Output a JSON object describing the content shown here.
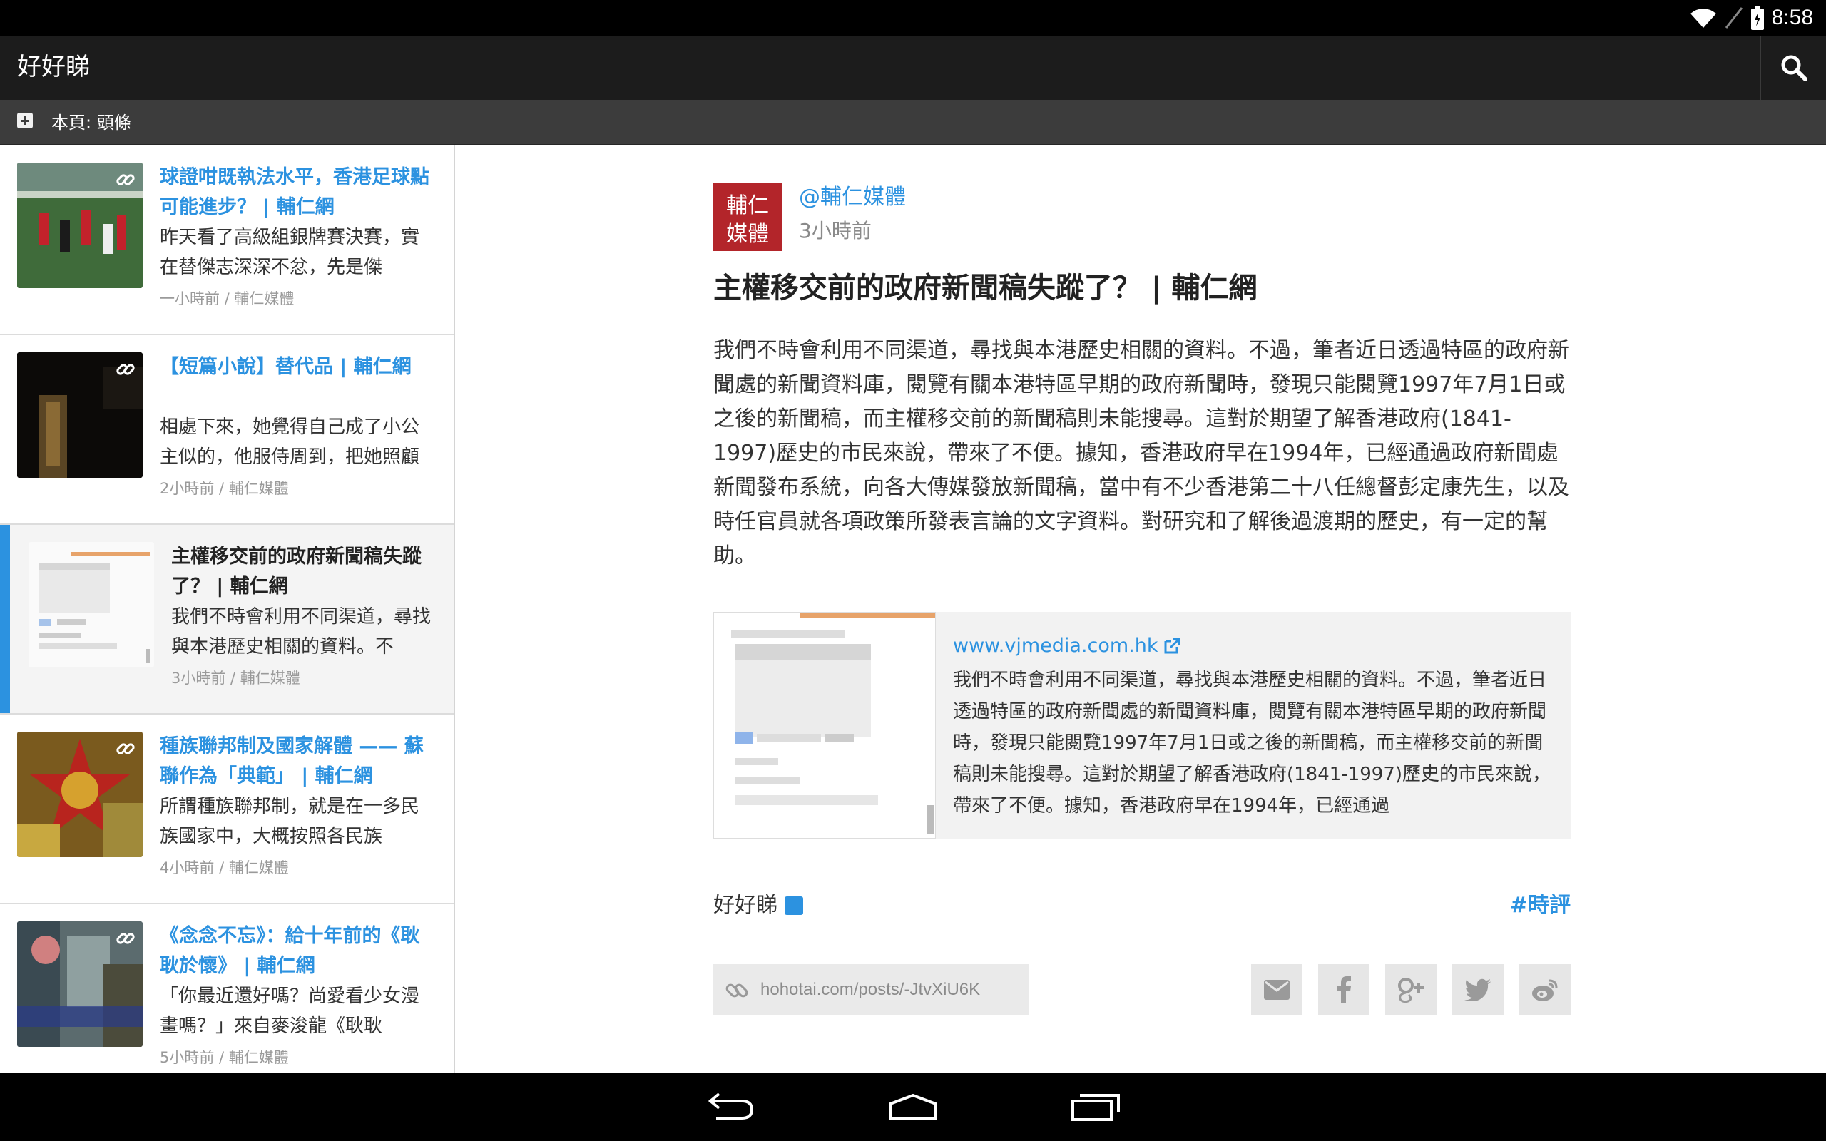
{
  "status": {
    "time": "8:58"
  },
  "app": {
    "title": "好好睇"
  },
  "subbar": {
    "page_label": "本頁: 頭條"
  },
  "feed": [
    {
      "title": "球證咁既執法水平，香港足球點可能進步？ | 輔仁網",
      "snippet": "昨天看了高級組銀牌賽決賽，實在替傑志深深不忿，先是傑",
      "meta": "一小時前 / 輔仁媒體"
    },
    {
      "title": "【短篇小說】替代品 | 輔仁網",
      "snippet": "相處下來，她覺得自己成了小公主似的，他服侍周到，把她照顧得無微不至。他在一間頗",
      "meta": "2小時前 / 輔仁媒體"
    },
    {
      "title": "主權移交前的政府新聞稿失蹤了？ | 輔仁網",
      "snippet": "我們不時會利用不同渠道，尋找與本港歷史相關的資料。不",
      "meta": "3小時前 / 輔仁媒體"
    },
    {
      "title": "種族聯邦制及國家解體 —— 蘇聯作為「典範」 | 輔仁網",
      "snippet": "所謂種族聯邦制，就是在一多民族國家中，大概按照各民族",
      "meta": "4小時前 / 輔仁媒體"
    },
    {
      "title": "《念念不忘》：給十年前的《耿耿於懷》 | 輔仁網",
      "snippet": "「你最近還好嗎？尚愛看少女漫畫嗎？」來自麥浚龍《耿耿",
      "meta": "5小時前 / 輔仁媒體"
    }
  ],
  "article": {
    "avatar_text": "輔仁媒體",
    "author": "@輔仁媒體",
    "time": "3小時前",
    "title": "主權移交前的政府新聞稿失蹤了？ | 輔仁網",
    "body": "我們不時會利用不同渠道，尋找與本港歷史相關的資料。不過，筆者近日透過特區的政府新聞處的新聞資料庫，閱覽有關本港特區早期的政府新聞時，發現只能閱覽1997年7月1日或之後的新聞稿，而主權移交前的新聞稿則未能搜尋。這對於期望了解香港政府(1841-1997)歷史的市民來說，帶來了不便。據知，香港政府早在1994年，已經通過政府新聞處新聞發布系統，向各大傳媒發放新聞稿，當中有不少香港第二十八任總督彭定康先生，以及時任官員就各項政策所發表言論的文字資料。對研究和了解後過渡期的歷史，有一定的幫助。",
    "card": {
      "url": "www.vjmedia.com.hk",
      "desc": "我們不時會利用不同渠道，尋找與本港歷史相關的資料。不過，筆者近日透過特區的政府新聞處的新聞資料庫，閱覽有關本港特區早期的政府新聞時，發現只能閱覽1997年7月1日或之後的新聞稿，而主權移交前的新聞稿則未能搜尋。這對於期望了解香港政府(1841-1997)歷史的市民來說，帶來了不便。據知，香港政府早在1994年，已經通過"
    },
    "source": "好好睇",
    "hashtag": "#時評",
    "share_url": "hohotai.com/posts/-JtvXiU6K"
  },
  "colors": {
    "accent": "#2c92e0",
    "avatar": "#b3252a"
  }
}
